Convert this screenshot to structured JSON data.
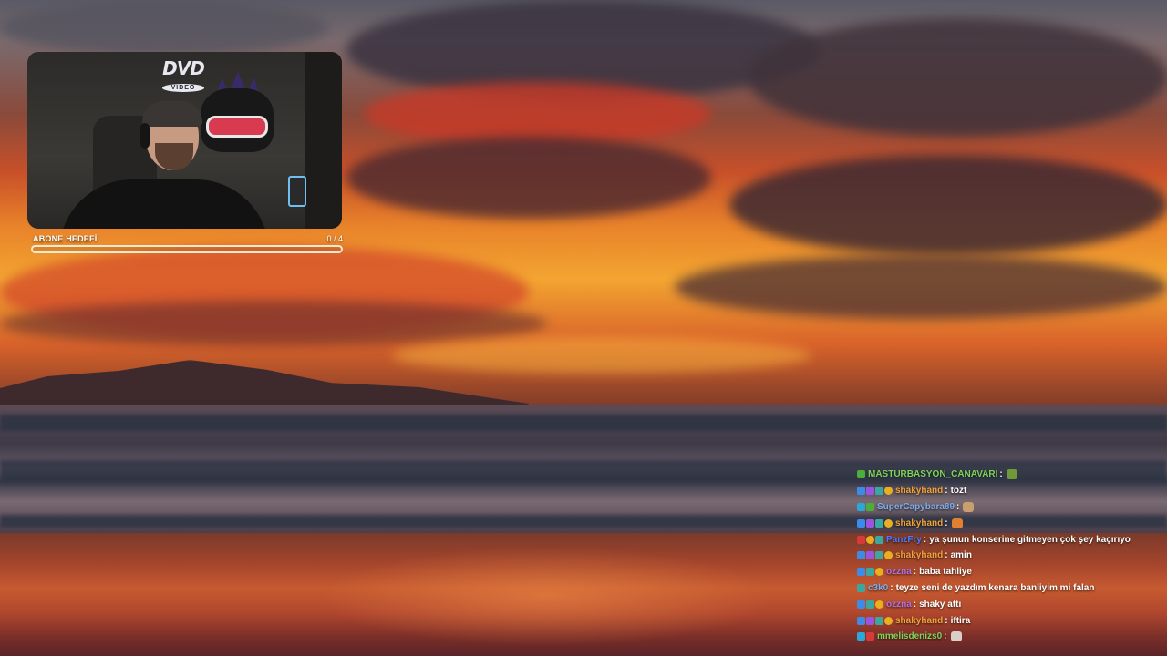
{
  "colors": {
    "goal_bar": "#f5e9d6",
    "chat_text": "#ffffff"
  },
  "webcam": {
    "overlay_logo": "DVD",
    "overlay_logo_sub": "VIDEO"
  },
  "subscriber_goal": {
    "label": "ABONE HEDEFİ",
    "count": "0 / 4",
    "progress_fraction": 0.0
  },
  "chat": {
    "messages": [
      {
        "user": "MASTURBASYON_CANAVARI",
        "user_color": "#7fd35a",
        "badges": [
          "green"
        ],
        "text": "",
        "emote": "pepe-emote",
        "emote_color": "#6e9a3a"
      },
      {
        "user": "shakyhand",
        "user_color": "#f0a23a",
        "badges": [
          "blue",
          "purple",
          "teal",
          "gold"
        ],
        "text": "tozt",
        "emote": "",
        "emote_color": ""
      },
      {
        "user": "SuperCapybara89",
        "user_color": "#7aaef0",
        "badges": [
          "cyan",
          "green"
        ],
        "text": "",
        "emote": "thinking-emote",
        "emote_color": "#c8a070"
      },
      {
        "user": "shakyhand",
        "user_color": "#f0a23a",
        "badges": [
          "blue",
          "purple",
          "teal",
          "gold"
        ],
        "text": "",
        "emote": "cat-emote",
        "emote_color": "#e08030"
      },
      {
        "user": "PanzFry",
        "user_color": "#4a7aff",
        "badges": [
          "red",
          "gold",
          "teal"
        ],
        "text": "ya şunun konserine gitmeyen çok şey kaçırıyo",
        "emote": "",
        "emote_color": ""
      },
      {
        "user": "shakyhand",
        "user_color": "#f0a23a",
        "badges": [
          "blue",
          "purple",
          "teal",
          "gold"
        ],
        "text": "amin",
        "emote": "",
        "emote_color": ""
      },
      {
        "user": "ozzna",
        "user_color": "#b070e0",
        "badges": [
          "blue",
          "teal",
          "gold"
        ],
        "text": "baba tahliye",
        "emote": "",
        "emote_color": ""
      },
      {
        "user": "c3k0",
        "user_color": "#7aaef0",
        "badges": [
          "teal"
        ],
        "text": "teyze seni de yazdım kenara banliyim mi falan",
        "emote": "",
        "emote_color": ""
      },
      {
        "user": "ozzna",
        "user_color": "#b070e0",
        "badges": [
          "blue",
          "teal",
          "gold"
        ],
        "text": "shaky attı",
        "emote": "",
        "emote_color": ""
      },
      {
        "user": "shakyhand",
        "user_color": "#f0a23a",
        "badges": [
          "blue",
          "purple",
          "teal",
          "gold"
        ],
        "text": "iftira",
        "emote": "",
        "emote_color": ""
      },
      {
        "user": "mmelisdenizs0",
        "user_color": "#7fd35a",
        "badges": [
          "cyan",
          "red"
        ],
        "text": "",
        "emote": "figure-emote",
        "emote_color": "#d8d0c8"
      }
    ]
  }
}
